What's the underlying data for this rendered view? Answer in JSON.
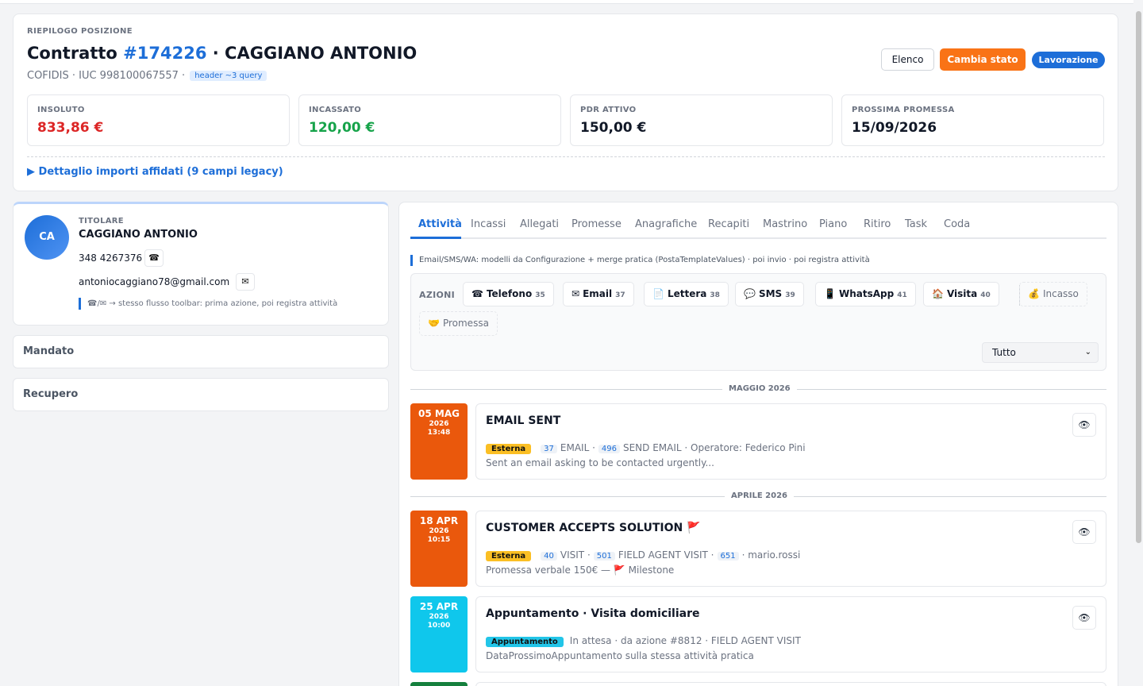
{
  "header": {
    "kicker": "RIEPILOGO POSIZIONE",
    "title_prefix": "Contratto ",
    "contract_number": "#174226",
    "title_suffix": " · CAGGIANO ANTONIO",
    "subline": "COFIDIS · IUC 998100067557 ·",
    "query_chip": "header ~3 query",
    "btn_elenco": "Elenco",
    "btn_cambia_stato": "Cambia stato",
    "status_pill": "Lavorazione",
    "kpis": [
      {
        "label": "INSOLUTO",
        "value": "833,86 €",
        "color": "#dc2626"
      },
      {
        "label": "INCASSATO",
        "value": "120,00 €",
        "color": "#16a34a"
      },
      {
        "label": "PDR ATTIVO",
        "value": "150,00 €",
        "color": "#111827"
      },
      {
        "label": "PROSSIMA PROMESSA",
        "value": "15/09/2026",
        "color": "#111827"
      }
    ],
    "detail_link": "▶ Dettaglio importi affidati (9 campi legacy)"
  },
  "titolare": {
    "initials": "CA",
    "kicker": "TITOLARE",
    "name": "CAGGIANO ANTONIO",
    "phone": "348 4267376",
    "phone_icon": "☎",
    "email": "antoniocaggiano78@gmail.com",
    "email_icon": "✉",
    "note": "☎/✉ → stesso flusso toolbar: prima azione, poi registra attività"
  },
  "accordions": [
    {
      "label": "Mandato"
    },
    {
      "label": "Recupero"
    }
  ],
  "tabs": [
    "Attività",
    "Incassi",
    "Allegati",
    "Promesse",
    "Anagrafiche",
    "Recapiti",
    "Mastrino",
    "Piano",
    "Ritiro",
    "Task",
    "Coda"
  ],
  "info_line": "Email/SMS/WA: modelli da Configurazione + merge pratica (PostaTemplateValues) · poi invio · poi registra attività",
  "actions": {
    "label": "AZIONI",
    "buttons": [
      {
        "icon": "☎",
        "label": "Telefono",
        "count": "35"
      },
      {
        "icon": "✉",
        "label": "Email",
        "count": "37"
      },
      {
        "icon": "📄",
        "label": "Lettera",
        "count": "38"
      },
      {
        "icon": "💬",
        "label": "SMS",
        "count": "39"
      },
      {
        "icon": "📱",
        "label": "WhatsApp",
        "count": "41"
      },
      {
        "icon": "🏠",
        "label": "Visita",
        "count": "40"
      }
    ],
    "ghost_buttons": [
      {
        "icon": "💰",
        "label": "Incasso"
      },
      {
        "icon": "🤝",
        "label": "Promessa"
      }
    ],
    "filter_selected": "Tutto"
  },
  "timeline": {
    "months": [
      "MAGGIO 2026",
      "APRILE 2026"
    ],
    "events": [
      {
        "day": "05 MAG",
        "year": "2026",
        "time": "13:48",
        "tile_color": "#ea580c",
        "title": "EMAIL SENT",
        "badge": "Esterna",
        "c1": "37",
        "t1": "EMAIL ·",
        "c2": "496",
        "t2": "SEND EMAIL · Operatore: Federico Pini",
        "desc": "Sent an email asking to be contacted urgently..."
      },
      {
        "day": "18 APR",
        "year": "2026",
        "time": "10:15",
        "tile_color": "#ea580c",
        "title": "CUSTOMER ACCEPTS SOLUTION 🚩",
        "badge": "Esterna",
        "c1": "40",
        "t1": "VISIT ·",
        "c2": "501",
        "t2": "FIELD AGENT VISIT ·",
        "c3": "651",
        "t3": "· mario.rossi",
        "desc": "Promessa verbale 150€ — 🚩 Milestone"
      },
      {
        "day": "25 APR",
        "year": "2026",
        "time": "10:00",
        "tile_color": "#0fc7ec",
        "title": "Appuntamento · Visita domiciliare",
        "badge": "Appuntamento",
        "meta": "In attesa · da azione #8812 · FIELD AGENT VISIT",
        "desc": "DataProssimoAppuntamento sulla stessa attività pratica"
      }
    ]
  },
  "icons": {
    "eye": "👁"
  }
}
